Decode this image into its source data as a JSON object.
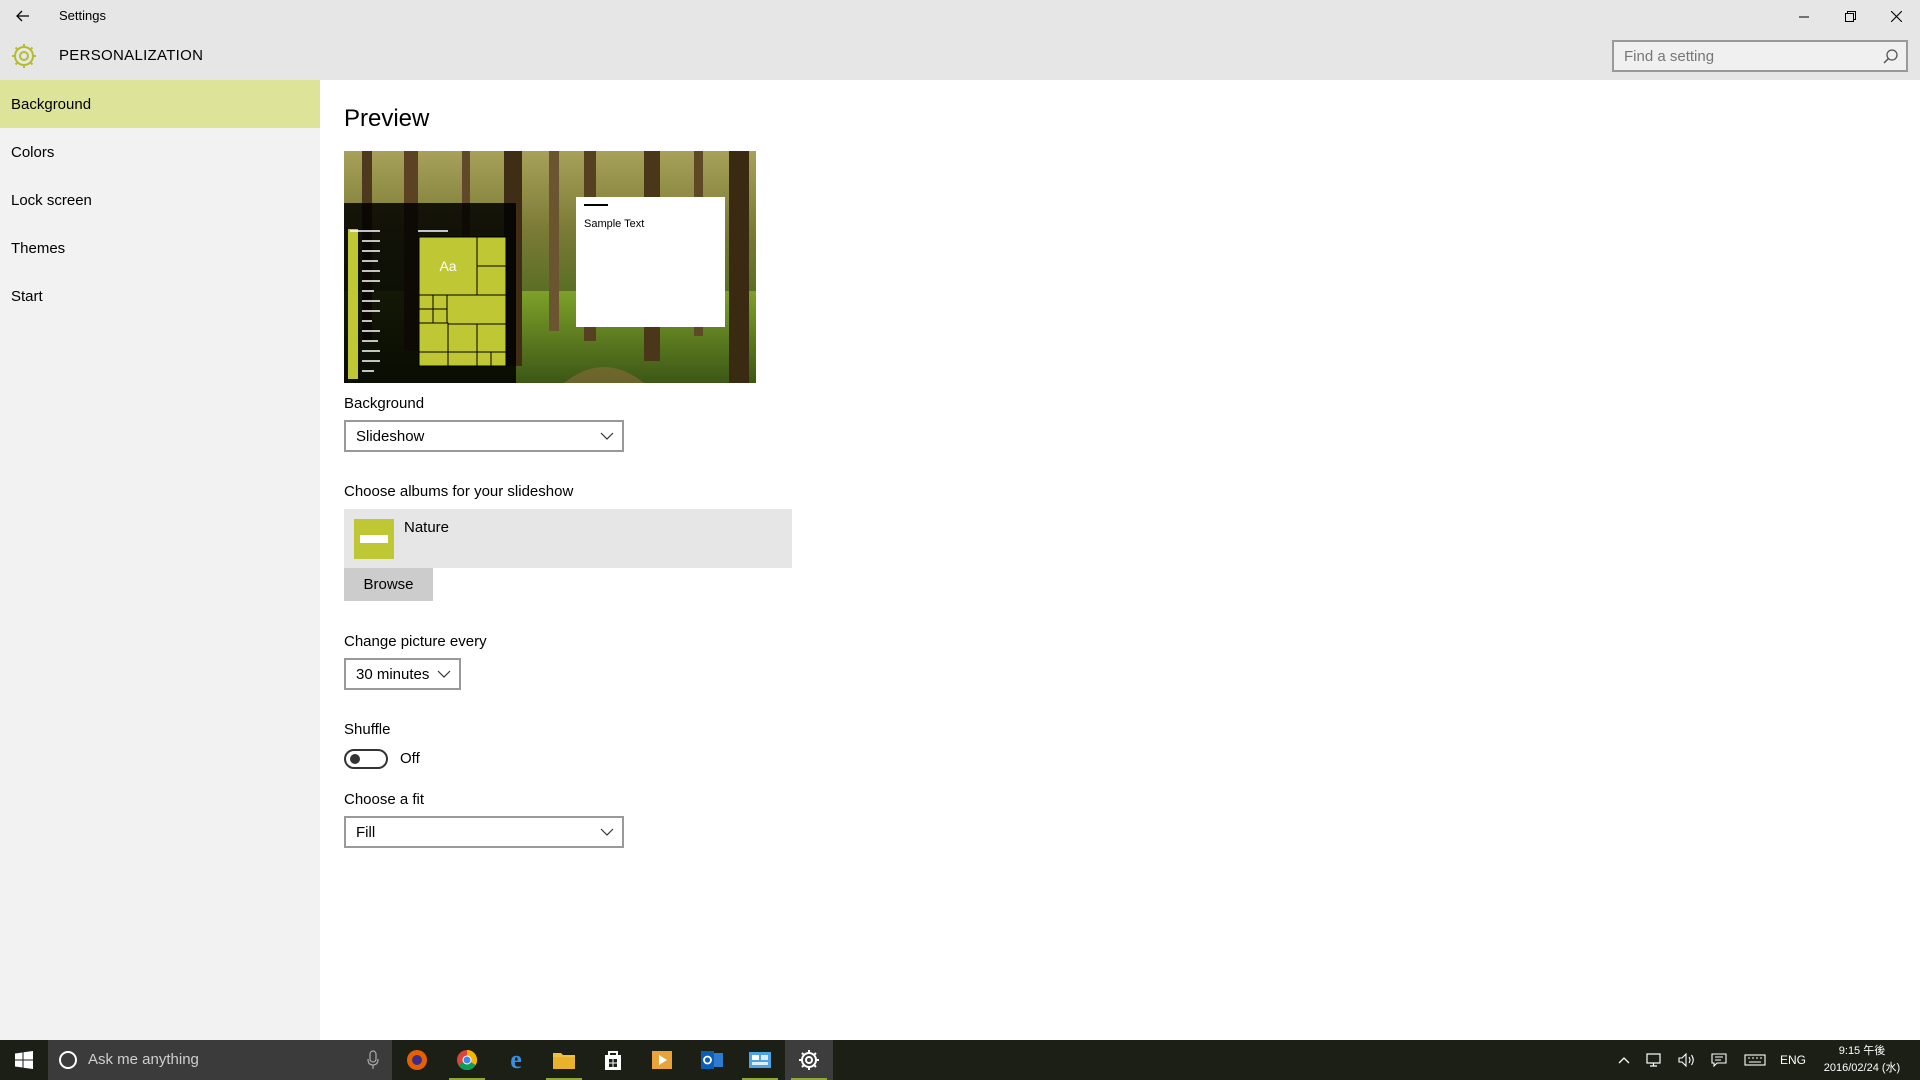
{
  "window": {
    "app_title": "Settings",
    "section_title": "PERSONALIZATION"
  },
  "search": {
    "placeholder": "Find a setting"
  },
  "sidebar": {
    "items": [
      {
        "label": "Background",
        "active": true
      },
      {
        "label": "Colors"
      },
      {
        "label": "Lock screen"
      },
      {
        "label": "Themes"
      },
      {
        "label": "Start"
      }
    ]
  },
  "main": {
    "preview_heading": "Preview",
    "preview_sample_text": "Sample Text",
    "preview_tile_label": "Aa",
    "background_label": "Background",
    "background_value": "Slideshow",
    "albums_label": "Choose albums for your slideshow",
    "album_name": "Nature",
    "browse_label": "Browse",
    "change_picture_label": "Change picture every",
    "change_picture_value": "30 minutes",
    "shuffle_label": "Shuffle",
    "shuffle_state": "Off",
    "fit_label": "Choose a fit",
    "fit_value": "Fill"
  },
  "taskbar": {
    "search_placeholder": "Ask me anything",
    "language": "ENG",
    "time": "9:15 午後",
    "date": "2016/02/24 (水)"
  },
  "colors": {
    "accent": "#c0c735",
    "accent_light": "#dde49a",
    "taskbar": "#1c1f16"
  }
}
